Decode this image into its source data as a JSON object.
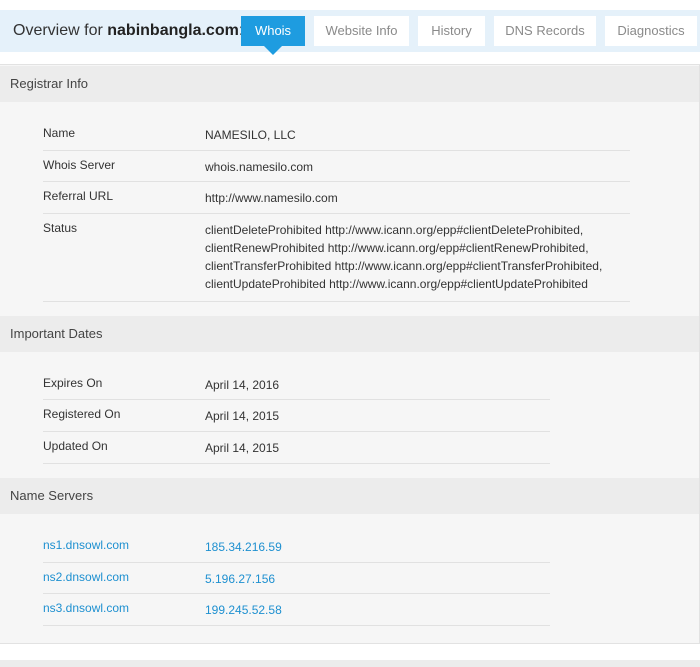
{
  "header": {
    "overview_prefix": "Overview for",
    "domain": "nabinbangla.com",
    "colon": ":",
    "tabs": [
      {
        "label": "Whois",
        "active": true
      },
      {
        "label": "Website Info",
        "active": false
      },
      {
        "label": "History",
        "active": false
      },
      {
        "label": "DNS Records",
        "active": false
      },
      {
        "label": "Diagnostics",
        "active": false
      }
    ]
  },
  "registrar_info": {
    "title": "Registrar Info",
    "rows": [
      {
        "key": "Name",
        "value": "NAMESILO, LLC"
      },
      {
        "key": "Whois Server",
        "value": "whois.namesilo.com"
      },
      {
        "key": "Referral URL",
        "value": "http://www.namesilo.com"
      },
      {
        "key": "Status",
        "value_lines": [
          "clientDeleteProhibited http://www.icann.org/epp#clientDeleteProhibited,",
          "clientRenewProhibited http://www.icann.org/epp#clientRenewProhibited,",
          "clientTransferProhibited http://www.icann.org/epp#clientTransferProhibited,",
          "clientUpdateProhibited http://www.icann.org/epp#clientUpdateProhibited"
        ]
      }
    ]
  },
  "important_dates": {
    "title": "Important Dates",
    "rows": [
      {
        "key": "Expires On",
        "value": "April 14, 2016"
      },
      {
        "key": "Registered On",
        "value": "April 14, 2015"
      },
      {
        "key": "Updated On",
        "value": "April 14, 2015"
      }
    ]
  },
  "name_servers": {
    "title": "Name Servers",
    "rows": [
      {
        "key": "ns1.dnsowl.com",
        "value": "185.34.216.59"
      },
      {
        "key": "ns2.dnsowl.com",
        "value": "5.196.27.156"
      },
      {
        "key": "ns3.dnsowl.com",
        "value": "199.245.52.58"
      }
    ]
  },
  "colors": {
    "accent": "#1e9ce0",
    "header_bg": "#e5f1fa",
    "link": "#1e90d0"
  }
}
